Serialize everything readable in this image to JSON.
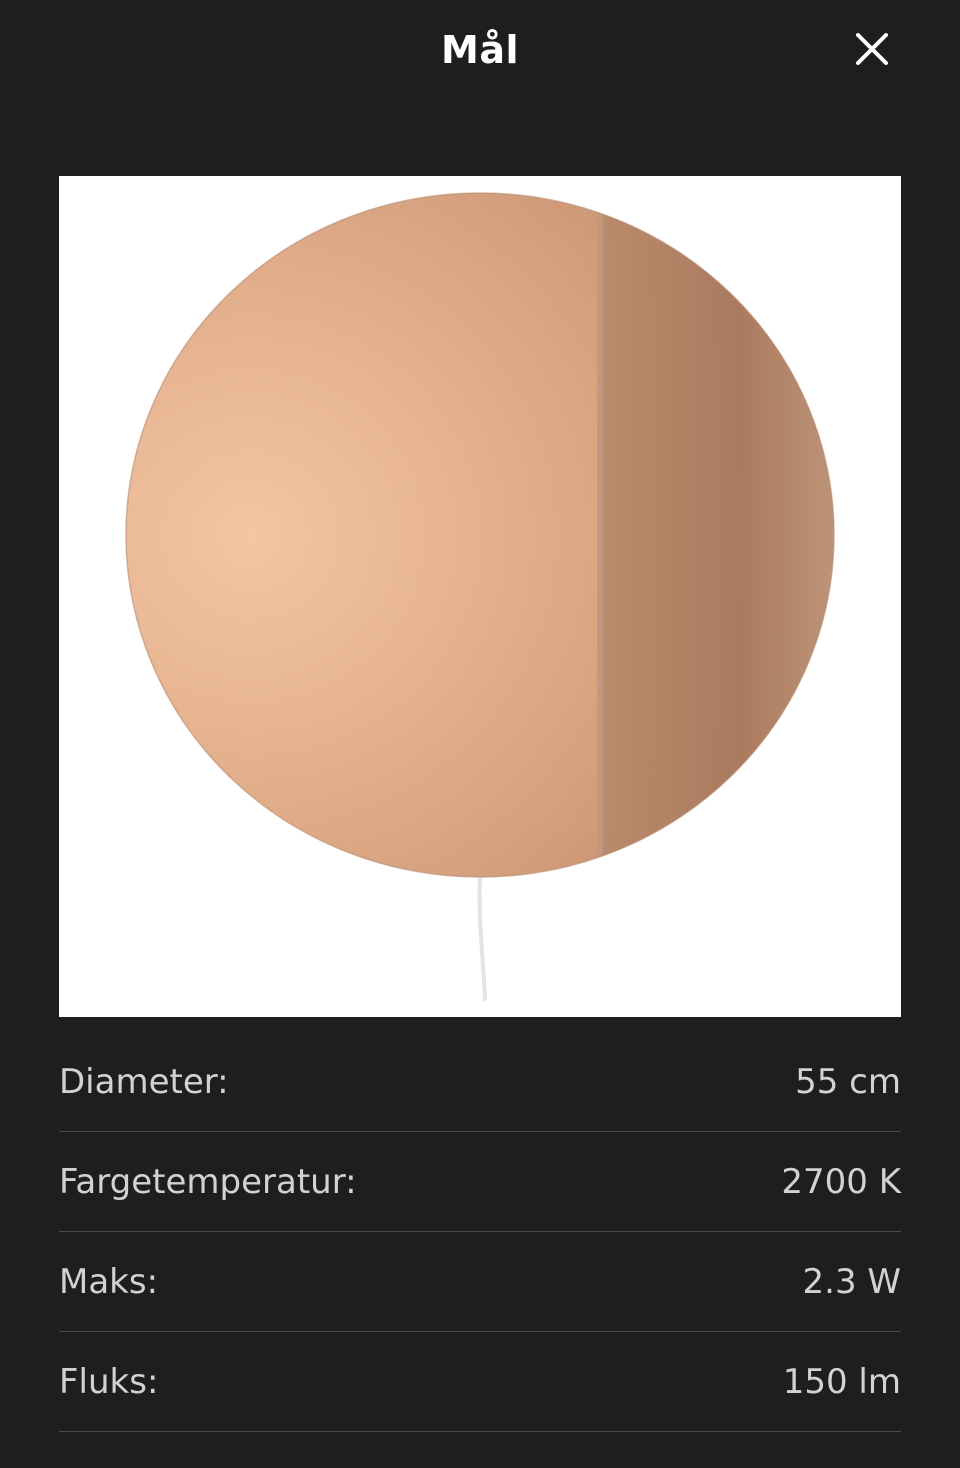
{
  "header": {
    "title": "Mål",
    "close_icon": "close-icon"
  },
  "product_image": {
    "subject": "round wall lamp",
    "colors": {
      "background": "#ffffff",
      "lamp_light": "#f0c0a0",
      "lamp_mid": "#d8a27e",
      "lamp_shadow": "#a57d64",
      "cord": "#e6e2dc"
    }
  },
  "specs": {
    "rows": [
      {
        "label": "Diameter:",
        "value": "55 cm"
      },
      {
        "label": "Fargetemperatur:",
        "value": "2700 K"
      },
      {
        "label": "Maks:",
        "value": "2.3 W"
      },
      {
        "label": "Fluks:",
        "value": "150 lm"
      }
    ]
  },
  "theme": {
    "background": "#1e1e20",
    "text": "#ffffff",
    "muted_text": "#d2d2d4",
    "divider": "#4a4a4d"
  }
}
